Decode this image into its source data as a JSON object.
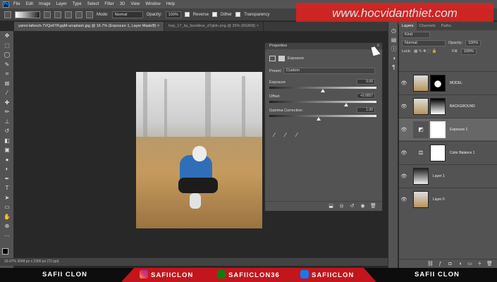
{
  "app": {
    "logo": "Ps"
  },
  "menu": [
    "File",
    "Edit",
    "Image",
    "Layer",
    "Type",
    "Select",
    "Filter",
    "3D",
    "View",
    "Window",
    "Help"
  ],
  "options": {
    "mode_label": "Mode:",
    "mode_value": "Normal",
    "opacity_label": "Opacity:",
    "opacity_value": "100%",
    "reverse": "Reverse",
    "dither": "Dither",
    "transparency": "Transparency"
  },
  "watermark": "www.hocvidanthiet.com",
  "tabs": [
    "yanni-lafesch-7VQo6YKgqM-unsplash.jpg @ 16.7% (Exposure 1, Layer Mask/8) ×",
    "hop_17_by_bundleur_d7gkln.png @ 25% (RGB/8) ×"
  ],
  "status": "16.67%    3048 px x 2300 px (72 ppi)",
  "properties": {
    "title": "Properties",
    "type_label": "Exposure",
    "preset_label": "Preset:",
    "preset_value": "Custom",
    "exposure_label": "Exposure",
    "exposure_value": "0.00",
    "offset_label": "Offset",
    "offset_value": "+0.0057",
    "gamma_label": "Gamma Correction:",
    "gamma_value": "1.00",
    "exposure_level": 0.5,
    "offset_level": 0.72,
    "gamma_level": 0.46
  },
  "layers_panel": {
    "tabs": [
      "Layers",
      "Channels",
      "Paths"
    ],
    "kind_label": "Kind",
    "blend": "Normal",
    "opacity_label": "Opacity:",
    "opacity_value": "100%",
    "lock_label": "Lock:",
    "fill_label": "Fill:",
    "fill_value": "100%",
    "layers": [
      {
        "name": "MODEL"
      },
      {
        "name": "BACKGROUND"
      },
      {
        "name": "Exposure 1"
      },
      {
        "name": "Color Balance 1"
      },
      {
        "name": "Layer 1"
      },
      {
        "name": "Layer 0"
      }
    ]
  },
  "banner": {
    "left": "SAFII CLON",
    "instagram": "SAFIICLON",
    "xbox": "SAFIICLON36",
    "facebook": "SAFIICLON",
    "right": "SAFII CLON"
  },
  "colors": {
    "accent": "#c3151c",
    "panel": "#535353",
    "canvas": "#282828"
  }
}
